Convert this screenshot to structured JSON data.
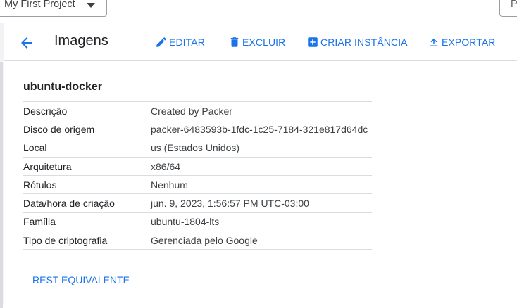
{
  "top_bar": {
    "project_name": "My First Project",
    "search_placeholder": "P"
  },
  "header": {
    "title": "Imagens",
    "actions": {
      "edit": "EDITAR",
      "delete": "EXCLUIR",
      "create_instance": "CRIAR INSTÂNCIA",
      "export": "EXPORTAR"
    }
  },
  "image": {
    "name": "ubuntu-docker",
    "details": [
      {
        "label": "Descrição",
        "value": "Created by Packer"
      },
      {
        "label": "Disco de origem",
        "value": "packer-6483593b-1fdc-1c25-7184-321e817d64dc"
      },
      {
        "label": "Local",
        "value": "us (Estados Unidos)"
      },
      {
        "label": "Arquitetura",
        "value": "x86/64"
      },
      {
        "label": "Rótulos",
        "value": "Nenhum"
      },
      {
        "label": "Data/hora de criação",
        "value": "jun. 9, 2023, 1:56:57 PM UTC-03:00"
      },
      {
        "label": "Família",
        "value": "ubuntu-1804-lts"
      },
      {
        "label": "Tipo de criptografia",
        "value": "Gerenciada pelo Google"
      }
    ]
  },
  "footer": {
    "rest_link": "REST EQUIVALENTE"
  },
  "colors": {
    "accent": "#1a73e8",
    "divider": "#dadce0",
    "text_primary": "#202124"
  }
}
